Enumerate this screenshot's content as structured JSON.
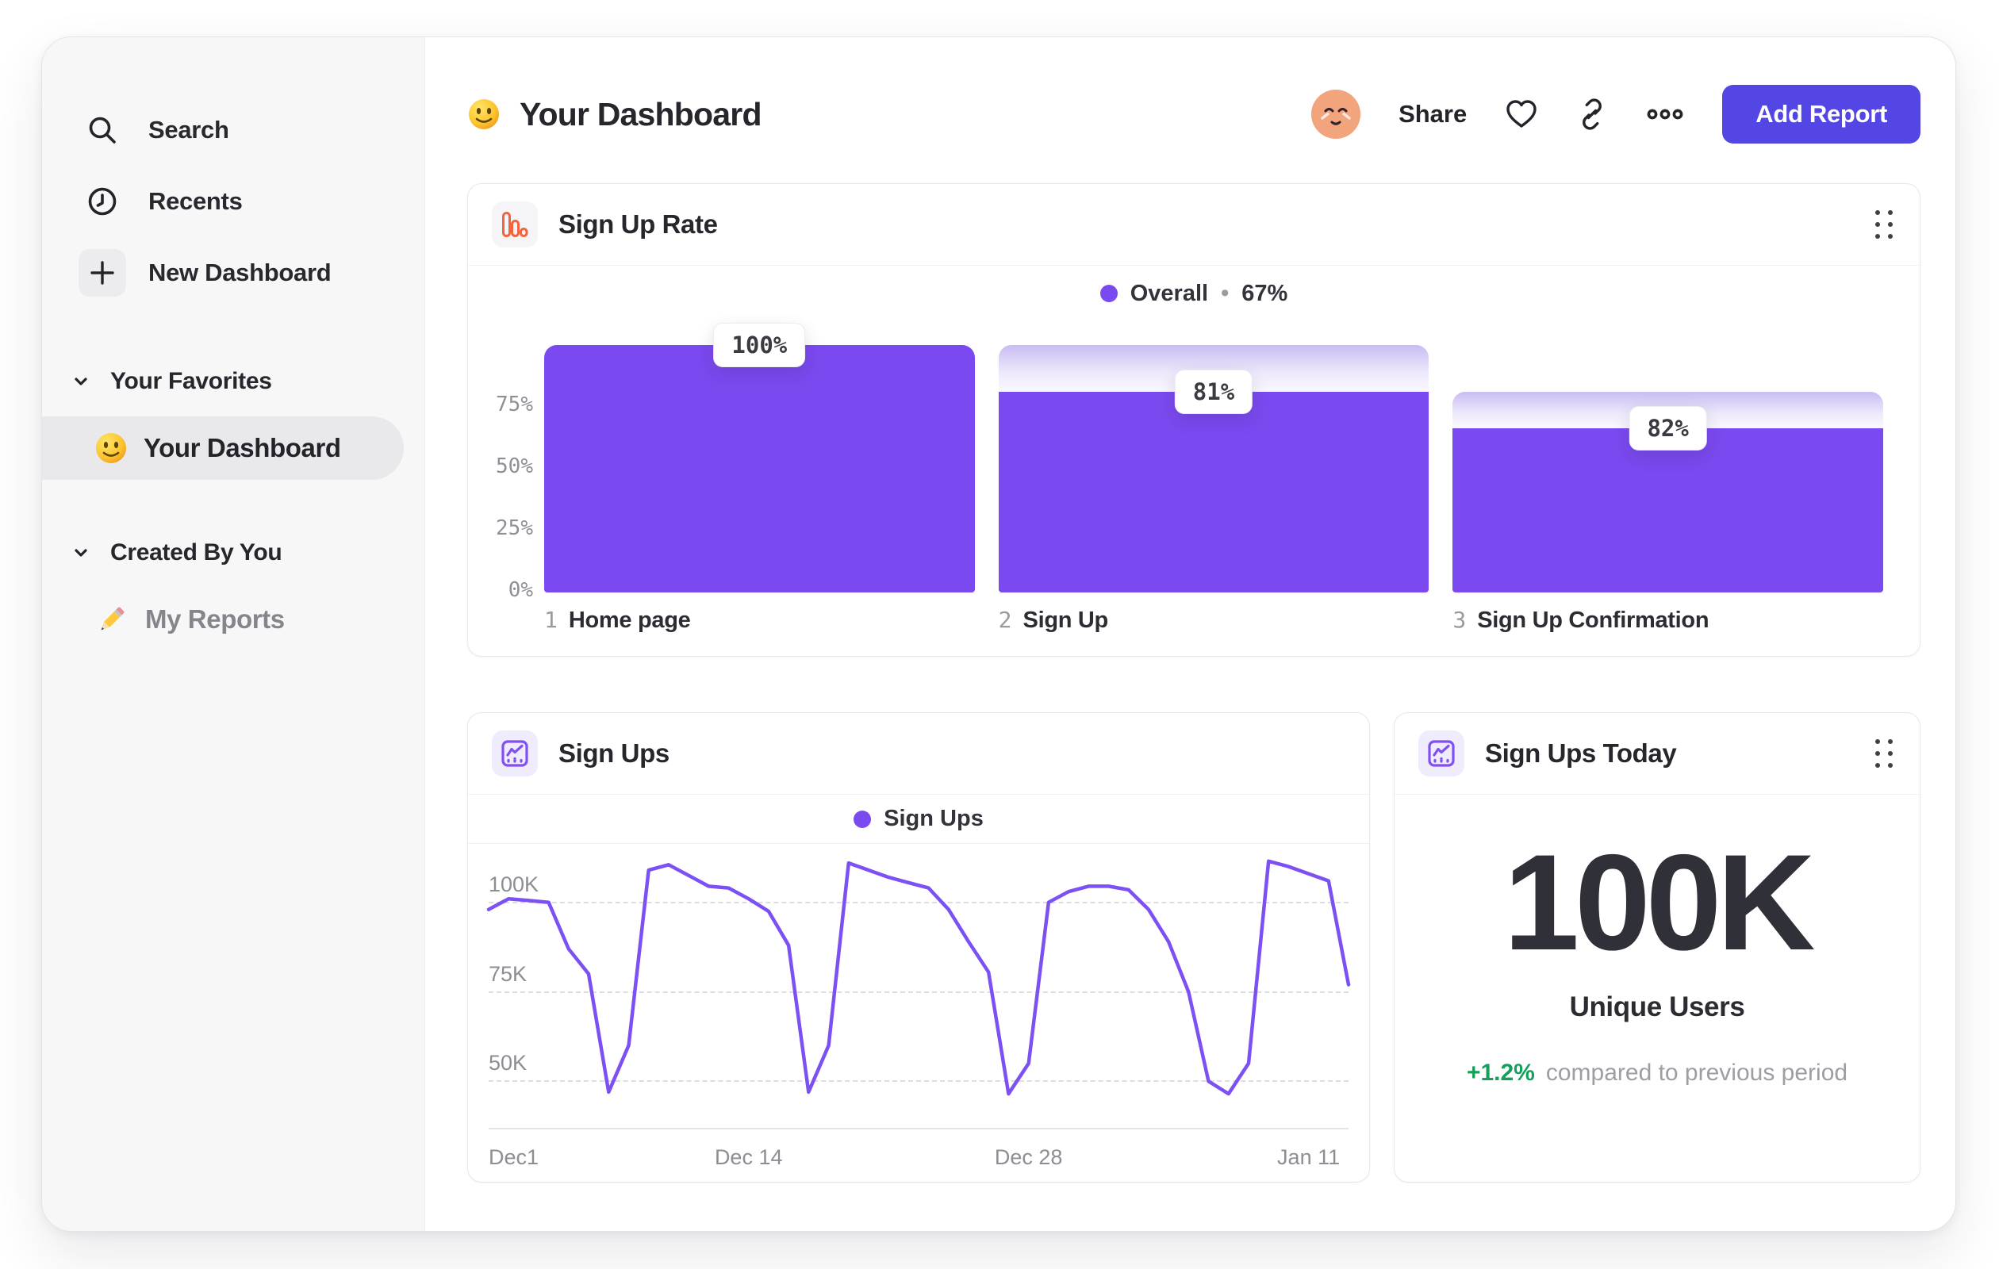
{
  "sidebar": {
    "top_items": [
      {
        "label": "Search",
        "icon": "search-icon"
      },
      {
        "label": "Recents",
        "icon": "clock-icon"
      },
      {
        "label": "New Dashboard",
        "icon": "plus-icon"
      }
    ],
    "sections": [
      {
        "title": "Your Favorites",
        "items": [
          {
            "label": "Your Dashboard",
            "icon": "slightly-smiling-face-emoji",
            "selected": true
          }
        ]
      },
      {
        "title": "Created By You",
        "items": [
          {
            "label": "My Reports",
            "icon": "pencil-emoji",
            "selected": false
          }
        ]
      }
    ]
  },
  "header": {
    "title": "Your Dashboard",
    "title_icon": "slightly-smiling-face-emoji",
    "share_label": "Share",
    "add_report_label": "Add Report"
  },
  "cards": {
    "sign_ups_today": {
      "title": "Sign Ups Today",
      "value": "100K",
      "value_label": "Unique Users",
      "delta": "+1.2%",
      "delta_note": "compared to previous period"
    }
  },
  "chart_data": [
    {
      "type": "bar",
      "subtype": "funnel",
      "title": "Sign Up Rate",
      "legend": {
        "label": "Overall",
        "separator": "•",
        "value": "67%",
        "color": "#7B49F0"
      },
      "categories": [
        "Home page",
        "Sign Up",
        "Sign Up Confirmation"
      ],
      "step_numbers": [
        "1",
        "2",
        "3"
      ],
      "step_conversion_labels": [
        "100%",
        "81%",
        "82%"
      ],
      "step_conversion_pct": [
        100,
        81,
        82
      ],
      "overall_pct": [
        100,
        81,
        66.4
      ],
      "y_ticks": [
        {
          "label": "75%",
          "pct": 75
        },
        {
          "label": "50%",
          "pct": 50
        },
        {
          "label": "25%",
          "pct": 25
        },
        {
          "label": "0%",
          "pct": 0
        }
      ],
      "ylim": [
        0,
        100
      ],
      "bar_color": "#7B49F0",
      "ghost_gradient": [
        "#C9BCF2",
        "#FAF8FE"
      ],
      "grid": false,
      "legend_position": "top-center"
    },
    {
      "type": "line",
      "title": "Sign Ups",
      "legend": {
        "label": "Sign Ups",
        "color": "#7B49F0"
      },
      "line_color": "#7B51F3",
      "x_tick_labels": [
        "Dec1",
        "Dec 14",
        "Dec 28",
        "Jan 11"
      ],
      "x_tick_day_index": [
        0,
        13,
        27,
        41
      ],
      "y_ticks": [
        {
          "label": "100K",
          "value_k": 100
        },
        {
          "label": "75K",
          "value_k": 75
        },
        {
          "label": "50K",
          "value_k": 50
        }
      ],
      "y_range_k": [
        37,
        115
      ],
      "values_k": [
        98,
        101,
        100.5,
        100,
        87,
        80,
        47,
        60,
        109,
        110.5,
        107.5,
        104.5,
        104,
        101,
        97.5,
        88,
        47,
        60,
        111,
        109,
        107,
        105.5,
        104,
        98,
        89,
        80.5,
        46.5,
        55,
        100,
        103,
        104.5,
        104.5,
        103.5,
        98,
        89,
        75,
        50,
        46.5,
        55,
        111.5,
        110,
        108,
        106,
        77
      ],
      "grid": "dashed-horizontal",
      "legend_position": "top-center"
    }
  ],
  "colors": {
    "accent_purple": "#7B49F0",
    "button_purple": "#5446E4",
    "positive_green": "#14A05C",
    "funnel_icon_orange": "#F4633C",
    "line_icon_purple": "#8250F0",
    "sidebar_bg": "#F7F7F8",
    "selected_pill": "#E9E9EB"
  }
}
